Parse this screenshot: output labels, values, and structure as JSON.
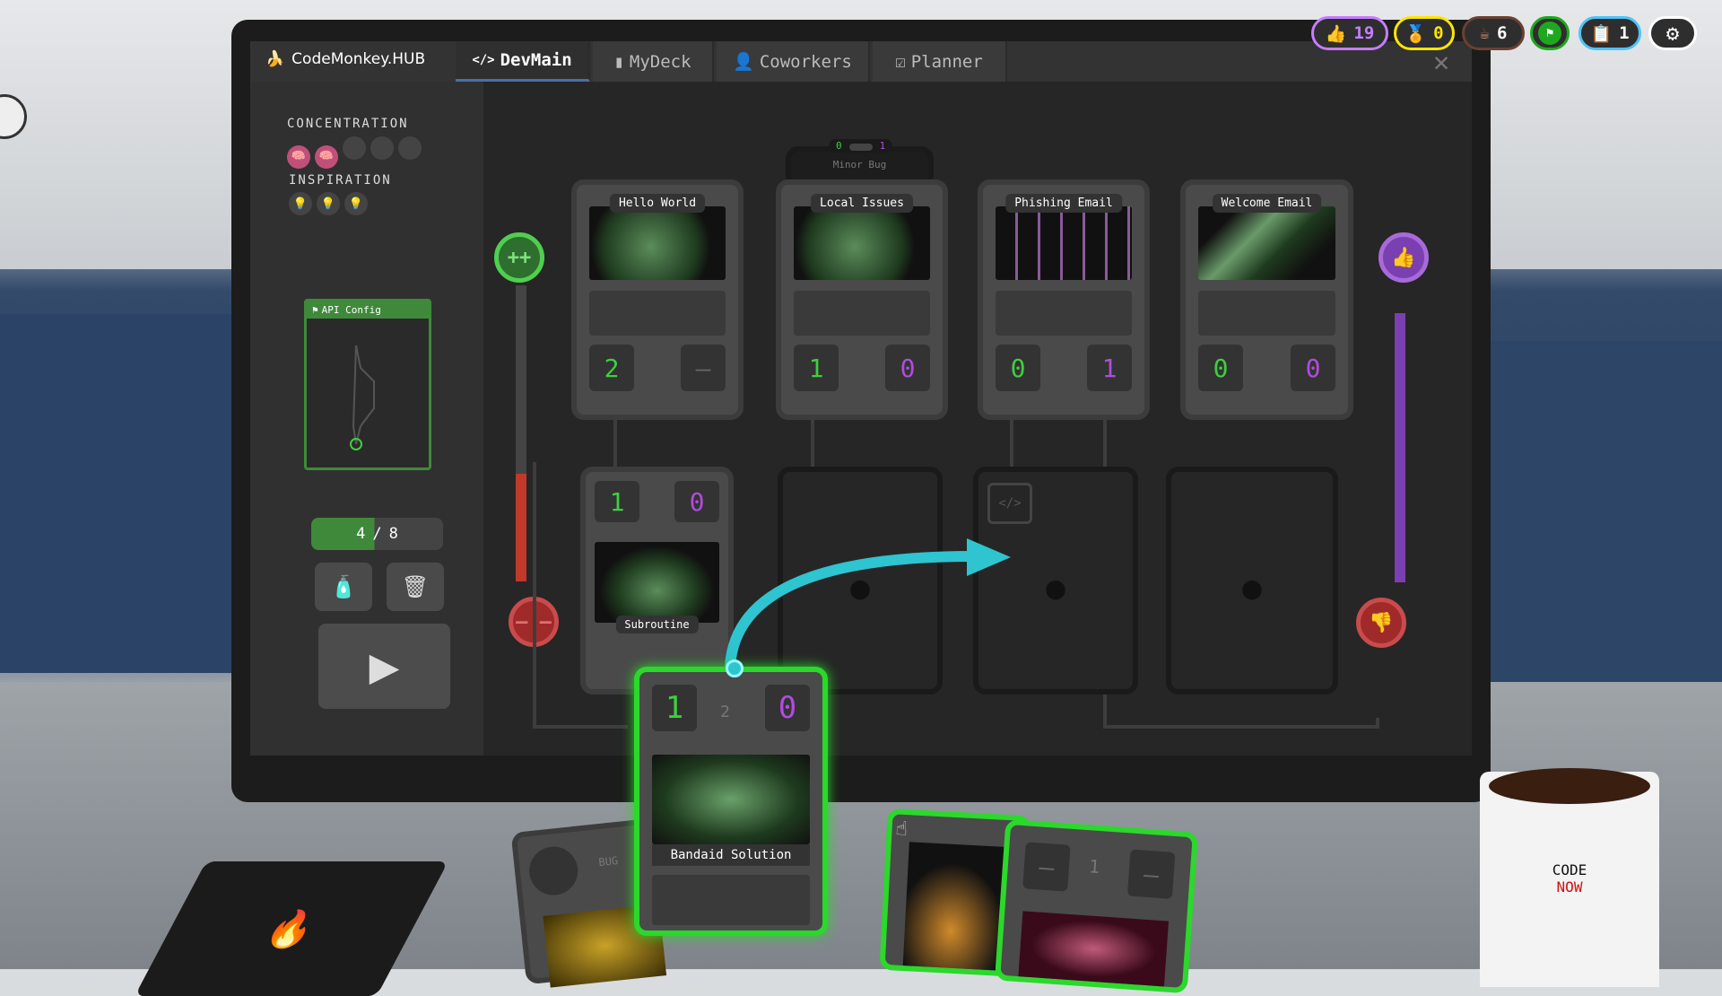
{
  "hud": {
    "likes": "19",
    "awards": "0",
    "coffee": "6",
    "tasks": "1",
    "colors": {
      "likes": "#c77dff",
      "awards": "#ffe600",
      "coffee": "#6b4033",
      "flag": "#1fa81f",
      "tasks": "#4fc3f7"
    }
  },
  "header": {
    "app_title": "CodeMonkey.HUB",
    "tabs": [
      {
        "label": "DevMain",
        "icon": "code-icon",
        "active": true
      },
      {
        "label": "MyDeck",
        "icon": "card-icon"
      },
      {
        "label": "Coworkers",
        "icon": "person-icon"
      },
      {
        "label": "Planner",
        "icon": "clipboard-icon"
      }
    ]
  },
  "left": {
    "concentration_label": "CONCENTRATION",
    "concentration_filled": 2,
    "concentration_total": 5,
    "inspiration_label": "INSPIRATION",
    "inspiration_filled": 0,
    "inspiration_total": 3,
    "api_card_title": "API Config",
    "deck_current": "4",
    "deck_sep": "/",
    "deck_total": "8"
  },
  "minor_bug": {
    "title": "Minor Bug",
    "left": "0",
    "right": "1"
  },
  "tasks": [
    {
      "title": "Hello World",
      "left": "2",
      "right": "–"
    },
    {
      "title": "Local Issues",
      "left": "1",
      "right": "0"
    },
    {
      "title": "Phishing Email",
      "left": "0",
      "right": "1"
    },
    {
      "title": "Welcome Email",
      "left": "0",
      "right": "0"
    }
  ],
  "subroutine": {
    "title": "Subroutine",
    "left": "1",
    "right": "0"
  },
  "selected_card": {
    "title": "Bandaid Solution",
    "left": "1",
    "cycle": "2",
    "right": "0"
  },
  "hand": [
    {
      "label": "BUG"
    },
    {
      "cycle": "1",
      "left": "–",
      "right": "–"
    }
  ],
  "buttons": {
    "plus": "++",
    "minus": "– –"
  },
  "mug": {
    "line1": "CODE",
    "line2": "NOW"
  },
  "colors": {
    "green": "#3ecf3e",
    "purple": "#b04ce0",
    "red": "#c0392b",
    "arrow": "#2ec4d0"
  }
}
